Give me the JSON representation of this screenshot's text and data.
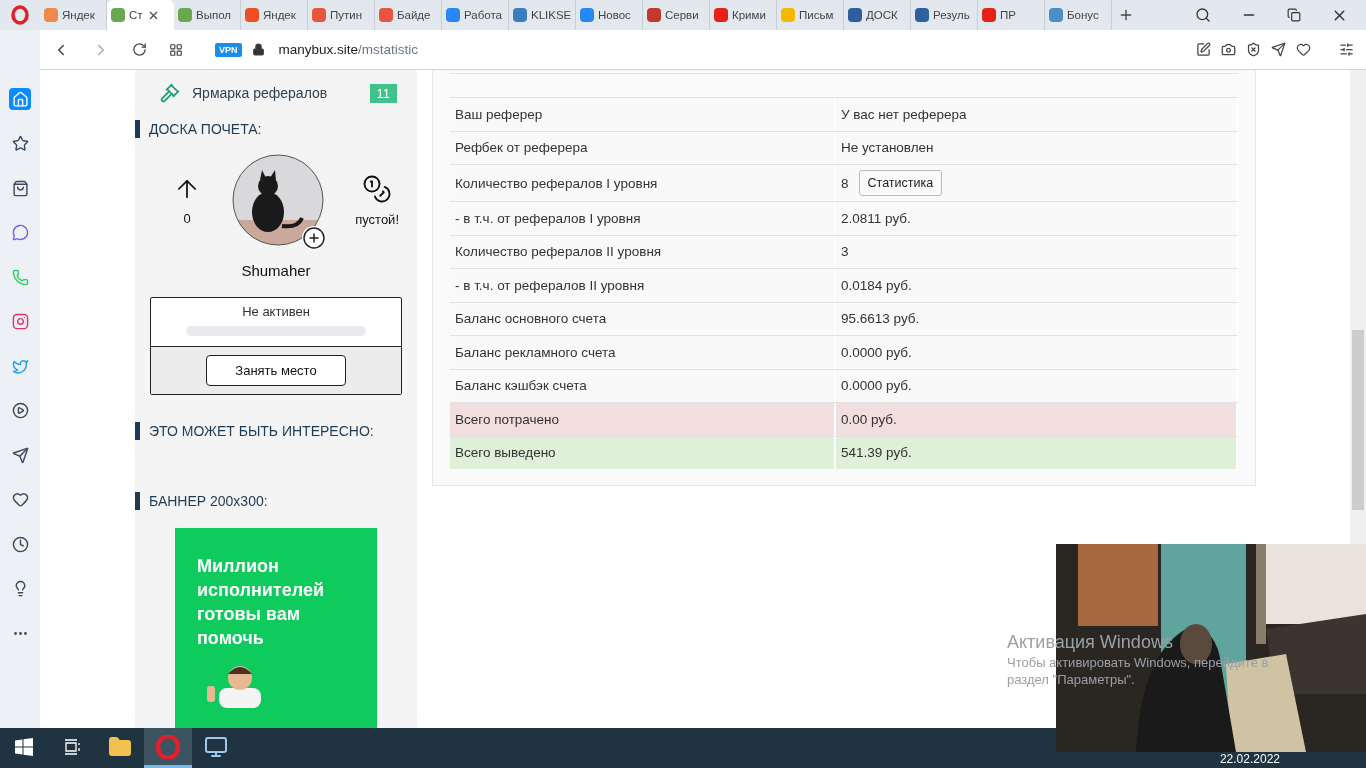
{
  "browser": {
    "tabs": [
      {
        "label": "Яндек",
        "color": "#f08a4b",
        "selected": false
      },
      {
        "label": "Ст",
        "color": "#6aa84f",
        "selected": true
      },
      {
        "label": "Выпол",
        "color": "#6aa84f",
        "selected": false
      },
      {
        "label": "Яндек",
        "color": "#f04e23",
        "selected": false
      },
      {
        "label": "Путин",
        "color": "#e8553e",
        "selected": false
      },
      {
        "label": "Байде",
        "color": "#e8553e",
        "selected": false
      },
      {
        "label": "Работа",
        "color": "#2787f5",
        "selected": false
      },
      {
        "label": "KLIKSE",
        "color": "#3b7bbf",
        "selected": false
      },
      {
        "label": "Новос",
        "color": "#2787f5",
        "selected": false
      },
      {
        "label": "Серви",
        "color": "#c0392b",
        "selected": false
      },
      {
        "label": "Крими",
        "color": "#e62117",
        "selected": false
      },
      {
        "label": "Письм",
        "color": "#f5b800",
        "selected": false
      },
      {
        "label": "ДОСК",
        "color": "#2f5f9e",
        "selected": false
      },
      {
        "label": "Резуль",
        "color": "#2f5f9e",
        "selected": false
      },
      {
        "label": "ПР",
        "color": "#e62117",
        "selected": false
      },
      {
        "label": "Бонус",
        "color": "#4a90c8",
        "selected": false
      }
    ],
    "vpn": "VPN",
    "url_host": "manybux.site",
    "url_path": "/mstatistic",
    "sidebar": [
      {
        "kind": "home",
        "selected": true
      },
      {
        "kind": "star",
        "selected": false
      },
      {
        "kind": "bag",
        "selected": false
      },
      {
        "kind": "messenger",
        "selected": false
      },
      {
        "kind": "whatsapp",
        "selected": false
      },
      {
        "kind": "instagram",
        "selected": false
      },
      {
        "kind": "twitter",
        "selected": false
      },
      {
        "kind": "player",
        "selected": false
      },
      {
        "kind": "send",
        "selected": false
      },
      {
        "kind": "heart",
        "selected": false
      },
      {
        "kind": "history",
        "selected": false
      },
      {
        "kind": "bulb",
        "selected": false
      },
      {
        "kind": "more",
        "selected": false
      }
    ]
  },
  "left": {
    "market": {
      "label": "Ярмарка рефералов",
      "badge": "11"
    },
    "honor_heading": "ДОСКА ПОЧЕТА:",
    "honor": {
      "up_count": "0",
      "coins_label": "пустой!",
      "name": "Shumaher",
      "status": "Не активен",
      "level": 0,
      "button": "Занять место"
    },
    "interest_heading": "ЭТО МОЖЕТ БЫТЬ ИНТЕРЕСНО:",
    "banner_heading": "БАННЕР 200x300:",
    "banner_text": "Миллион исполнителей готовы вам помочь"
  },
  "table": {
    "rows": [
      {
        "label": "Ваш реферер",
        "value": "У вас нет реферера",
        "kind": "plain"
      },
      {
        "label": "Рефбек от реферера",
        "value": "Не установлен",
        "kind": "plain"
      },
      {
        "label": "Количество рефералов I уровня",
        "value": "8",
        "button": "Статистика",
        "kind": "plain"
      },
      {
        "label": "- в т.ч. от рефералов I уровня",
        "value": "2.0811 руб.",
        "kind": "plain"
      },
      {
        "label": "Количество рефералов II уровня",
        "value": "3",
        "kind": "plain"
      },
      {
        "label": "- в т.ч. от рефералов II уровня",
        "value": "0.0184 руб.",
        "kind": "plain"
      },
      {
        "label": "Баланс основного счета",
        "value": "95.6613 руб.",
        "kind": "plain"
      },
      {
        "label": "Баланс рекламного счета",
        "value": "0.0000 руб.",
        "kind": "plain"
      },
      {
        "label": "Баланс кэшбэк счета",
        "value": "0.0000 руб.",
        "kind": "plain"
      },
      {
        "label": "Всего потрачено",
        "value": "0.00 руб.",
        "kind": "danger"
      },
      {
        "label": "Всего выведено",
        "value": "541.39 руб.",
        "kind": "success"
      }
    ]
  },
  "windows_notice": {
    "title": "Активация Windows",
    "line_1": "Чтобы активировать Windows, перейдите в",
    "line_2": "раздел \"Параметры\"."
  },
  "taskbar": {
    "items": [
      {
        "kind": "start",
        "selected": false
      },
      {
        "kind": "taskview",
        "selected": false
      },
      {
        "kind": "explorer",
        "selected": false
      },
      {
        "kind": "opera",
        "selected": true
      },
      {
        "kind": "network",
        "selected": false
      }
    ],
    "date": "22.02.2022"
  }
}
